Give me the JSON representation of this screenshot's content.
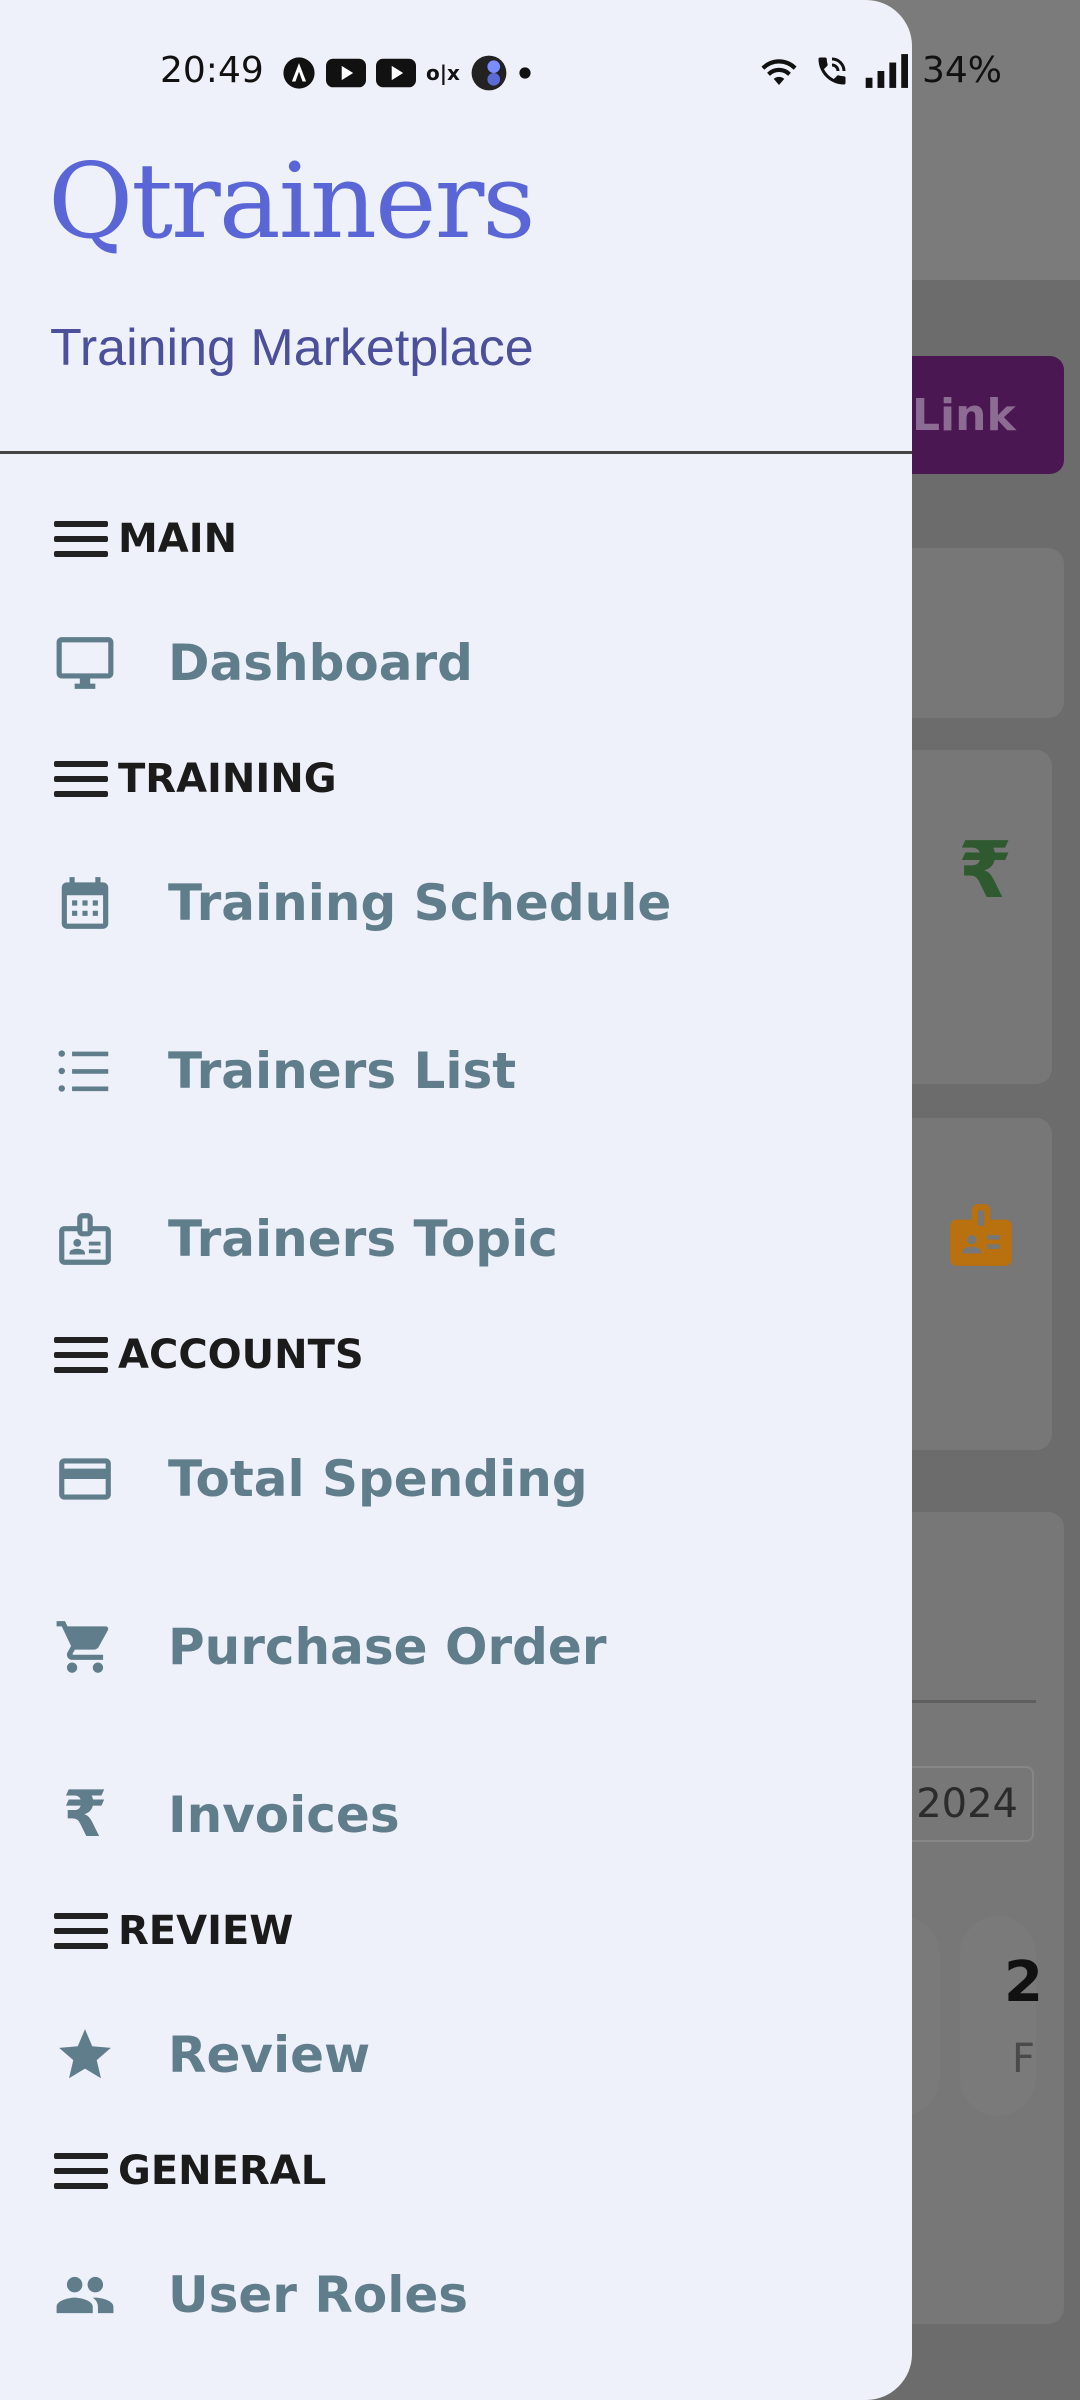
{
  "status_bar": {
    "time": "20:49",
    "battery": "34%",
    "icons": [
      "vpn-icon",
      "youtube-icon",
      "youtube-icon",
      "olx-icon",
      "app-icon",
      "dot-icon",
      "wifi-icon",
      "call-icon",
      "signal-icon"
    ]
  },
  "drawer": {
    "logo_text": "Qtrainers",
    "subtitle": "Training Marketplace",
    "sections": {
      "main": "MAIN",
      "training": "TRAINING",
      "accounts": "ACCOUNTS",
      "review": "REVIEW",
      "general": "GENERAL"
    },
    "items": {
      "dashboard": "Dashboard",
      "training_schedule": "Training Schedule",
      "trainers_list": "Trainers List",
      "trainers_topic": "Trainers Topic",
      "total_spending": "Total Spending",
      "purchase_order": "Purchase Order",
      "invoices": "Invoices",
      "review": "Review",
      "user_roles": "User Roles"
    }
  },
  "background": {
    "link_button": "Link",
    "year": "2024",
    "stat_number": "2",
    "stat_label": "F"
  },
  "colors": {
    "drawer_bg": "#eef1f9",
    "logo": "#5a66d6",
    "item_text": "#5f7d8a",
    "link_button_bg": "#4a1752"
  }
}
